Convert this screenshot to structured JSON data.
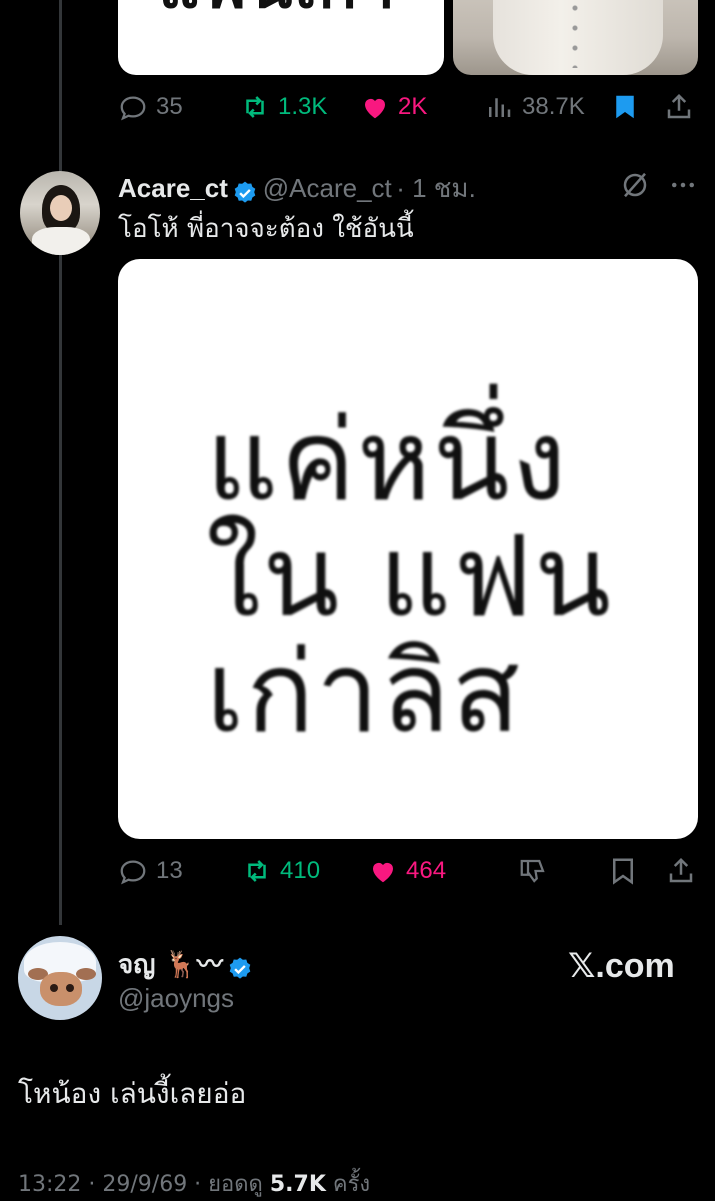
{
  "prev_tweet": {
    "image_fragment_text": "แฟนเก่า",
    "actions": {
      "replies": "35",
      "retweets": "1.3K",
      "likes": "2K",
      "views": "38.7K"
    },
    "icons": [
      "reply-icon",
      "retweet-icon",
      "heart-filled-icon",
      "views-icon",
      "bookmark-filled-icon",
      "share-icon"
    ]
  },
  "reply_tweet": {
    "display_name": "Acare_ct",
    "handle": "@Acare_ct",
    "time": "· 1 ชม.",
    "text": "โอโห้ พี่อาจจะต้อง ใช้อันนี้",
    "image_lines": [
      "แค่หนึ่ง",
      "ใน แฟน",
      "เก่าลิส"
    ],
    "actions": {
      "replies": "13",
      "retweets": "410",
      "likes": "464"
    }
  },
  "main_tweet": {
    "display_name": "จญ 🦌〰",
    "handle": "@jaoyngs",
    "brand": "𝕏.com",
    "text": "โหน้อง เล่นงี้เลยอ่อ",
    "footer": {
      "time_date": "13:22 · 29/9/69 · ยอดดู",
      "views": "5.7K",
      "suffix": "ครั้ง"
    }
  },
  "colors": {
    "background": "#000000",
    "muted": "#71767b",
    "retweet_green": "#00ba7c",
    "like_pink": "#f91880",
    "verified_blue": "#1d9bf0"
  }
}
